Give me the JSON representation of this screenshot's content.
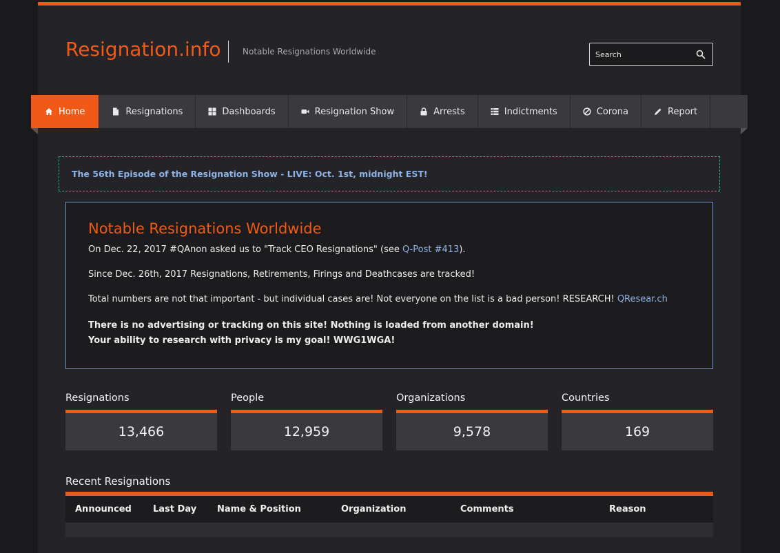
{
  "site": {
    "title": "Resignation.info",
    "tagline": "Notable Resignations Worldwide",
    "accent_color": "#f05a16",
    "link_color": "#8fb2e6"
  },
  "search": {
    "placeholder": "Search",
    "icon": "search-icon"
  },
  "nav": {
    "items": [
      {
        "label": "Home",
        "icon": "home-icon",
        "active": true
      },
      {
        "label": "Resignations",
        "icon": "document-icon"
      },
      {
        "label": "Dashboards",
        "icon": "grid-icon"
      },
      {
        "label": "Resignation Show",
        "icon": "video-camera-icon"
      },
      {
        "label": "Arrests",
        "icon": "lock-icon"
      },
      {
        "label": "Indictments",
        "icon": "list-icon"
      },
      {
        "label": "Corona",
        "icon": "ban-icon"
      },
      {
        "label": "Report",
        "icon": "pencil-icon"
      }
    ]
  },
  "announcement": "The 56th Episode of the Resignation Show - LIVE: Oct. 1st, midnight EST!",
  "intro": {
    "heading": "Notable Resignations Worldwide",
    "p1_before": "On Dec. 22, 2017 #QAnon asked us to \"Track CEO Resignations\" (see ",
    "p1_link": "Q-Post #413",
    "p1_after": ").",
    "p2": "Since Dec. 26th, 2017 Resignations, Retirements, Firings and Deathcases are tracked!",
    "p3_before": "Total numbers are not that important - but individual cases are! Not everyone on the list is a bad person! RESEARCH! ",
    "p3_link": "QResear.ch",
    "bold1": "There is no advertising or tracking on this site! Nothing is loaded from another domain!",
    "bold2": "Your ability to research with privacy is my goal! WWG1WGA!"
  },
  "stats": [
    {
      "label": "Resignations",
      "value": "13,466"
    },
    {
      "label": "People",
      "value": "12,959"
    },
    {
      "label": "Organizations",
      "value": "9,578"
    },
    {
      "label": "Countries",
      "value": "169"
    }
  ],
  "recent": {
    "title": "Recent Resignations",
    "columns": [
      "Announced",
      "Last Day",
      "Name & Position",
      "Organization",
      "Comments",
      "Reason"
    ]
  }
}
